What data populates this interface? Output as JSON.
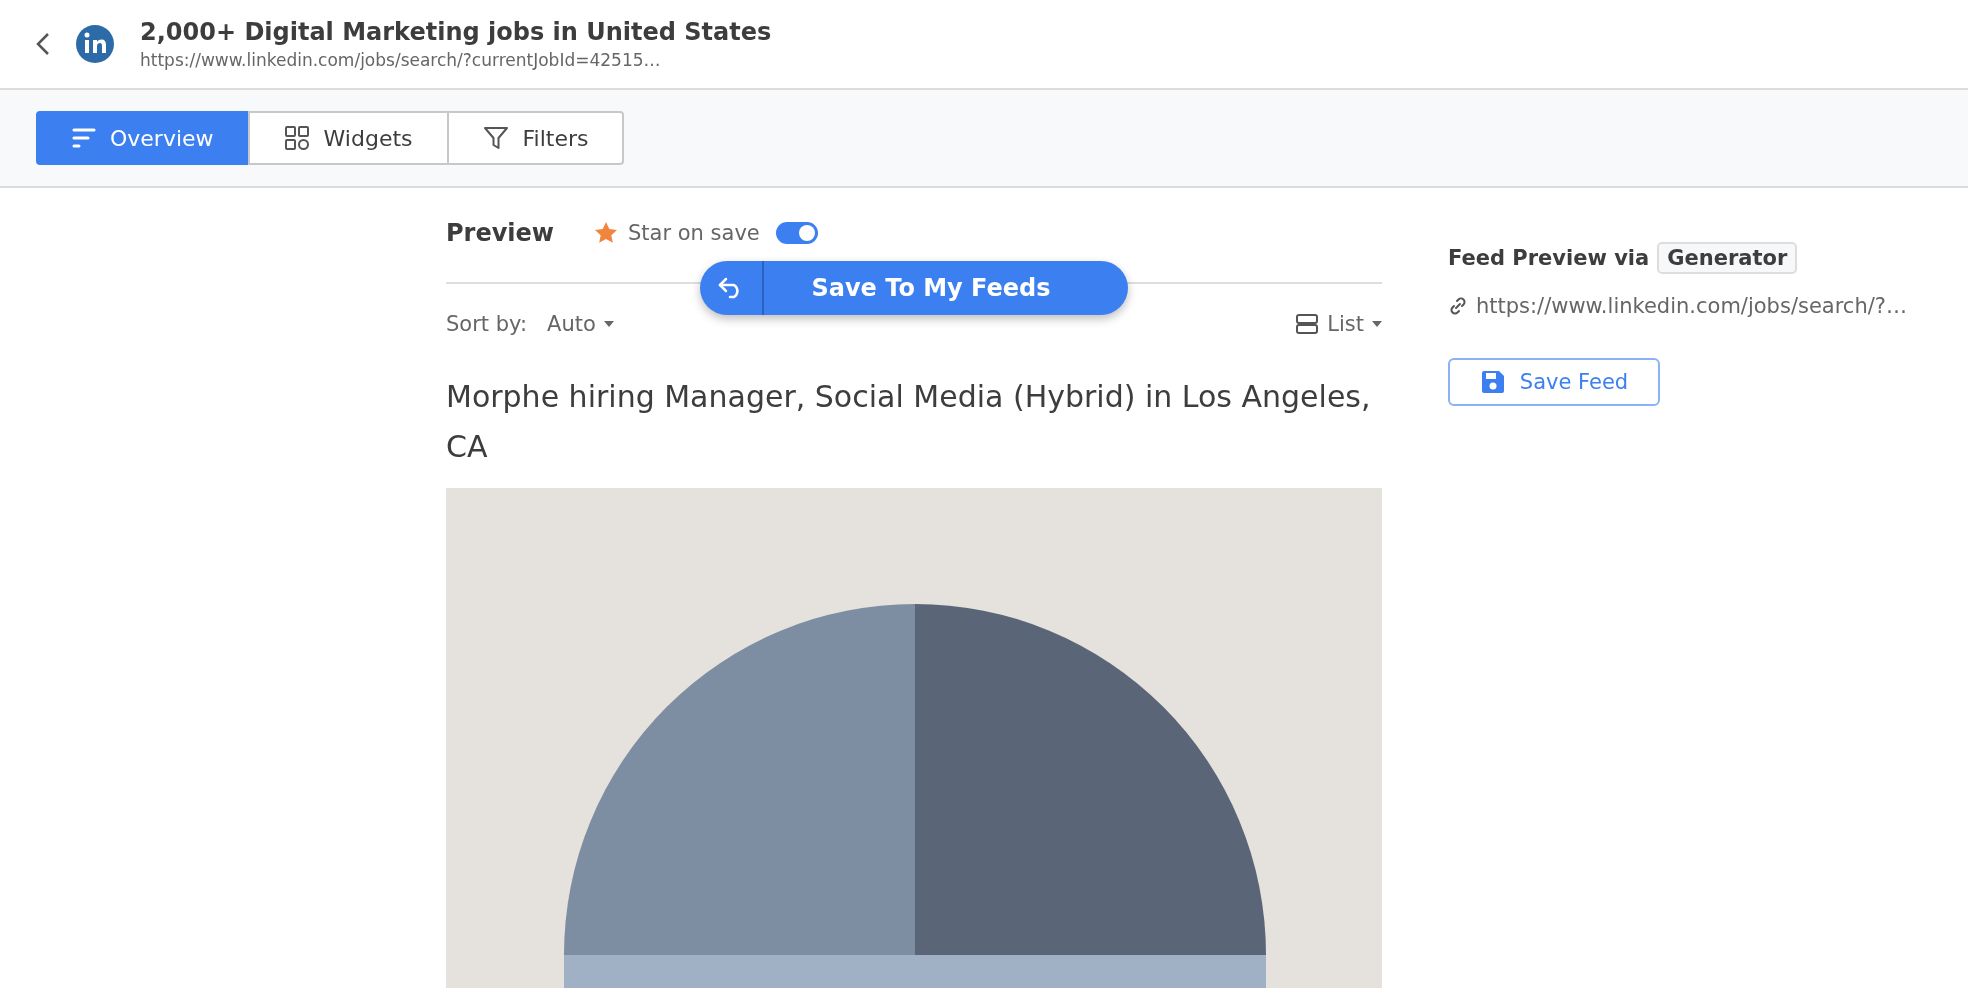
{
  "header": {
    "title": "2,000+ Digital Marketing jobs in United States",
    "url": "https://www.linkedin.com/jobs/search/?currentJobId=42515…"
  },
  "tabs": [
    {
      "label": "Overview",
      "selected": true,
      "kind": "overview"
    },
    {
      "label": "Widgets",
      "selected": false,
      "kind": "widgets"
    },
    {
      "label": "Filters",
      "selected": false,
      "kind": "filters"
    }
  ],
  "preview": {
    "heading": "Preview",
    "star_label": "Star on save",
    "star_on_save": true,
    "save_button": "Save To My Feeds",
    "sort_label": "Sort by:",
    "sort_value": "Auto",
    "view_value": "List"
  },
  "item": {
    "title": "Morphe hiring Manager, Social Media (Hybrid) in Los Angeles, CA"
  },
  "feed_panel": {
    "label": "Feed Preview via",
    "source": "Generator",
    "url": "https://www.linkedin.com/jobs/search/?…",
    "save_button": "Save Feed"
  }
}
